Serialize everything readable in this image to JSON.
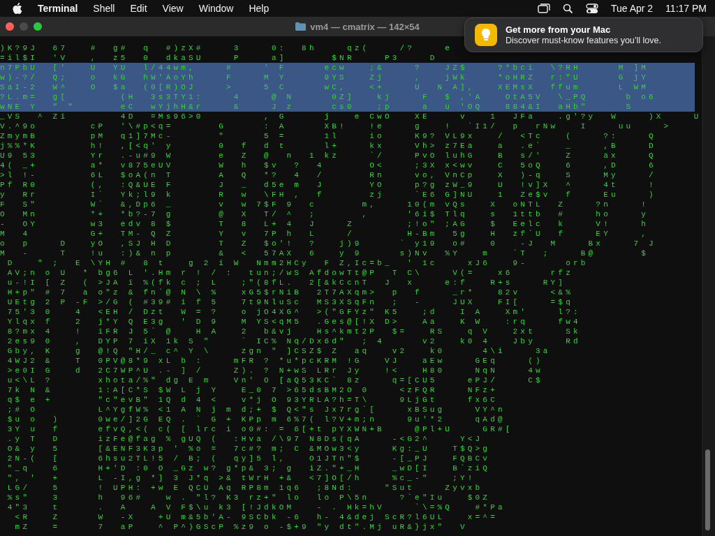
{
  "menu_bar": {
    "app": "Terminal",
    "items": [
      "Shell",
      "Edit",
      "View",
      "Window",
      "Help"
    ],
    "date": "Tue Apr 2",
    "time": "11:17 PM"
  },
  "window": {
    "title": "vm4 — cmatrix — 142×54"
  },
  "notification": {
    "title": "Get more from your Mac",
    "body": "Discover must-know features you’ll love."
  },
  "terminal": {
    "lines": [
      {
        "text": ") K ? 9 J     6 7       #     g #     q     # ) z X #         3         0 :     8 h         q z (         / ?         e",
        "selected": false
      },
      {
        "text": "= i l $ I     ' V       ,     z 5     0     d k a S U         P         a ]             $ N R         P 3         D",
        "selected": false
      },
      {
        "text": "n 7 P b U     [ '       U     Y U     l / 4 4 w m ,         #         '   F           e c w       ; &         ?       J Z $         ? * b c i     \\ ? R H           M   ] M",
        "selected": true
      },
      {
        "text": "w ) - ? /     Q ;       o     k G     h W ' A o Y h         F         M   Y           9 Y S       Z j         ,       j W k         * o H R Z     r : \" U           G   j Y",
        "selected": true
      },
      {
        "text": "S a I - 2     W ^       O     $ a     ( 0 [ R ) O J         >         5   C           w C ,       < +         U     N   A ] ,       X E M s X     f f u m           L   W M",
        "selected": true
      },
      {
        "text": "? L . m =     g [               ( H     3 s 3 T Y 1 :         4         @   N           0 Z ]       k j         F     $   , ' A       O t A 5 V     \\ _ P Q           b   o 6",
        "selected": true
      },
      {
        "text": "w N E   Y     \"   \"             e C     w Y j h H & r         &         J   z           c s 0       ; p         a     u   ' O Q       8 8 4 & I     a H b \"           S",
        "selected": true
      },
      {
        "text": "_ V S     ^   Z i               4 D     = M s 9 6 > 0                 ,   G           j       e   C w O       X E         v       1     J F a       . g ' ? y     W         ) X         U",
        "selected": false
      },
      {
        "text": "V . ^ 9 o               c P     ' \\ # p < q =             G           :   A           X B !       ! e         g       !     ` I 1 /     p     r N w       I         u u         >",
        "selected": false
      },
      {
        "text": "Z m y m B               p M     q 1 ] 7 M c -             \"           5   =           1 l         i o         K 9 ?   V L 9 x       /     < T c       (         ? :         Q",
        "selected": false
      },
      {
        "text": "j % % * K               h !     , [ < q '   y             0     f     d   t           l +         k x         V h >   z 7 E a       a     . e `       _         , B         D",
        "selected": false
      },
      {
        "text": "U 9   5 3               Y r     . - u # 9   W             e     Z     @     n     1   k z         ` /         P v O   l u h G       B     s / '       Z         a x         Q",
        "selected": false
      },
      {
        "text": "4 (   _ +               a *     v 8 7 5 e U V             W     h     $ v     ?     4             O <         ; 3 X   x < w v       C     5 o Q       6         , D         6",
        "selected": false
      },
      {
        "text": "> l   ! -               6 L     $ o A ( n   T             A     Q     * ?     4     /             R n         v o ,   V n C p       X     ) - q       S         M y         /",
        "selected": false
      },
      {
        "text": "P f   R 0               ( ,     : Q & U E   F             J     _     d 5 e   m     J             Y O         p ? g   z W _ 9       U     ! v ] X     ^         4 t         !",
        "selected": false
      },
      {
        "text": "y     R r               I `     Y k ; l 9   k             R     w     \\ F H   ,     f             z j         ` E 6   G ] N U       1     Z e $ v     f         E u         )",
        "selected": false
      },
      {
        "text": "F     S \"               W `     & , D p 6   _             v     w   7 $ F   9     c             m ,         1 0 ( m   v Q s       X     o N T L     Z         ? n         !",
        "selected": false
      },
      {
        "text": "O     M n               * +     * b ? - 7   g             @     X     T /   ^     ;             ,           ' 6 i $   T l q       s     1 t t b     #         h o         y",
        "selected": false
      },
      {
        "text": "-     O Y               w 3     e d v   8   $             T     8     L +   4     J         Z               ; ! o \"   ; A G       $     E e l c     k         V !         h",
        "selected": false
      },
      {
        "text": "M     4                 G +     T M -   Q   Z             Y     v     7 P   h     L         /               H - B m     5 g       H     z f ` U     f         E Y         ,",
        "selected": false
      },
      {
        "text": "o     p         D       y O     , S J   H   D             T     Z     $ o ' !     ?       j ) 9           `   y 1 9     o #       0       - J     M         B x         7   J",
        "selected": false
      },
      {
        "text": "M     -         T       ! u     : ) &   n   p             &     <     5 7 A X     6       y   9           s ) N v     % Y       m       ` T     ;         B @             $",
        "selected": false
      },
      {
        "text": "  D       \"   ;     E   \\ Y H   #     8   t       g   2   i   W     N m m 2 H C y     F   Z , I c = b _     '   1 c         x J 6       9 -           o r b",
        "selected": false
      },
      {
        "text": "  A V ; n   o   U     *   b g 6   L   ' . H m   r   !   /   :     t u n ; / w S   A f d o w T t @ P     T   C \\         V ( =       x 6           r f z",
        "selected": false
      },
      {
        "text": "  u - ! I   [   Z     (   > J A   i   % ( f k   c   ;   L       ; \" ( 8 f L .     2 [ & k C c n T     J     x         e : f       R + s         R Y ]",
        "selected": false
      },
      {
        "text": "  H + p \"   #   7     a   o \" z   &   f n ` @   N   \\   %       x G 5 $ r N i B     2 T 7 A X q m >     p     f         _ r *       8 2 v         < & %",
        "selected": false
      },
      {
        "text": "  U E t g   2   P   - F   > / G   (   # 3 9 #   i   f   5       7 t 9 N l u S c     M S 3 X S q F n     ;     -         J U X       F I [         = $ q",
        "selected": false
      },
      {
        "text": "  7 5 ' 3   0       4     < E H   /   D z t     W   =   ?       o   j O 4 X G ^     > ( \" G F Y z \"   K 5       ; d       I   A       X m '         l ? :",
        "selected": false
      },
      {
        "text": "  Y l q x   f       2     j * Y   Q   E 3 g     '   D   9       M   Y S < q M 5     . G e s @ [ ! X   D >       A a       K   W       : r q         f w 4",
        "selected": false
      },
      {
        "text": "  8 ? m x   4       !     i F R   J   5 `   @       H   A       2     b & v j       H s ^ k m t 2 P     $ =       R S       q   V       2 x t         S k",
        "selected": false
      },
      {
        "text": "  2 e s 9   0       ,     D Y P   7   i X   1 k   S   \"         `   I C %   N q / D x 6 d \"     ;   4           v 2       k 0   4       J b y         R d",
        "selected": false
      },
      {
        "text": "  G b y ,   K       g     @ ! Q   \" H / _   c ^   Y   \\         z g n   \"   ] C S Z $   Z     a q       v 2       k 0           4 \\ i         3 a",
        "selected": false
      },
      {
        "text": "  4 W J 2   &       T     0 P V @ 8 * 9   x L   b   :         m F R   ?   * u * p c K R M   ! G       V J       a E w         G E q         ( )",
        "selected": false
      },
      {
        "text": "  > e 0 I   G       d     2 C 7 W P ^ U   . -   ]   /         Z ) .   ?   N + w S   L R r   J y       ! <       H 8 0         N q N         4 w",
        "selected": false
      },
      {
        "text": "  u < \\ L   ?             x h o t a / % \"   d g   E   m       V n '   O   [ a Q 5 3 K C `   8 z         q = [ C U 5         e P J /         C $",
        "selected": false
      },
      {
        "text": "  7 k   N   &             1 : A [ C * S   $ W   L   j   Y       E _ 0   7   > 6 5 d s B M 2 O   0         < z F Q R         N F z +",
        "selected": false
      },
      {
        "text": "  q $   e   +             \" c \" e v B \"   1 Q   d   4   <       v * j   O   9 3 Y R L A ? h = T \\         9 L j G t         f x 6 C",
        "selected": false
      },
      {
        "text": "  ; #   O                 L ^ Y g f W %   < 1   A   N   j   m   d ; +   $   Q < \" s   J x 7 r g ` [         x B S u g         V Y ^ n",
        "selected": false
      },
      {
        "text": "  $ u   o     )           0 w e / ] 2 G   E Q   .   `   G   +   K P p   m   6 % 7 (   l ? V + m ; n         9 u ' * 2         q A d @",
        "selected": false
      },
      {
        "text": "  3 Y   u     f           e f v Q , < (   c (   [   l r c   i   o 0 # :   =   6 [ + t   p Y X W N + B         @ P l + U         G R # [",
        "selected": false
      },
      {
        "text": "  . y   T     D           i z F e @ f a g   %   g U Q   (     : H v a   / \\ 9 7   N 8 D s ( q A         - < G 2 ^         Y < J",
        "selected": false
      },
      {
        "text": "  O &   y     5           [ & E N F 3 K 3 p   '   % o   =     7 c # ?   m ;   C   & M O w 3 < y         K g : _ U       T $ Q > g",
        "selected": false
      },
      {
        "text": "  2 N - (     [           6 h s u 2 T L ! 5   /   B ;   (     q y ] 5   l ,       O 1 J T n \" $         - [ _ P J       F Q B C v",
        "selected": false
      },
      {
        "text": "  \" _ q       6           H + ' D   : 0   O   _ G z   w ?   g * p &   3 ;   g     i Z . \" + _ H         _ w D [ I       B ` z i Q",
        "selected": false
      },
      {
        "text": "  \" ,   '     +           L   - I , g   * ]   3   J * q   > &   t W r H   + &     < 7 ] O [ / h         % c _ - \"       ; Y !",
        "selected": false
      },
      {
        "text": "  L G /       5           !   U P H :   + w   E   Q C U   A q   R P 8 m   1 q 6     ; 8 N d :         \" S u t         Z y v x b",
        "selected": false
      },
      {
        "text": "  % s \"       3           h     9 6 #       w   .   \" l ?   K 3   r z + \"   l o     l o   P \\ 5 n         ? ` e \" I u       $ 0 Z",
        "selected": false
      },
      {
        "text": "  4 \" 3       t           .     A       A   V   F $ \\ u   k 3   [ ! J d k O M       -   .   H k = h V         ` \\ = % Q       # * P a",
        "selected": false
      },
      {
        "text": "    < R       Z           W     - X       + U   m & 5 b ' A -   9 S C b k   - 6     h -   4 & d e j   S c R ? l 6 U L       x = ^ =",
        "selected": false
      },
      {
        "text": "    m Z       =           7     a P       ^   P ^ ) G S c P   % z 9   o   - $ + 9   \" y   d t \" . M j   u R & } j x \"     V",
        "selected": false
      }
    ]
  }
}
